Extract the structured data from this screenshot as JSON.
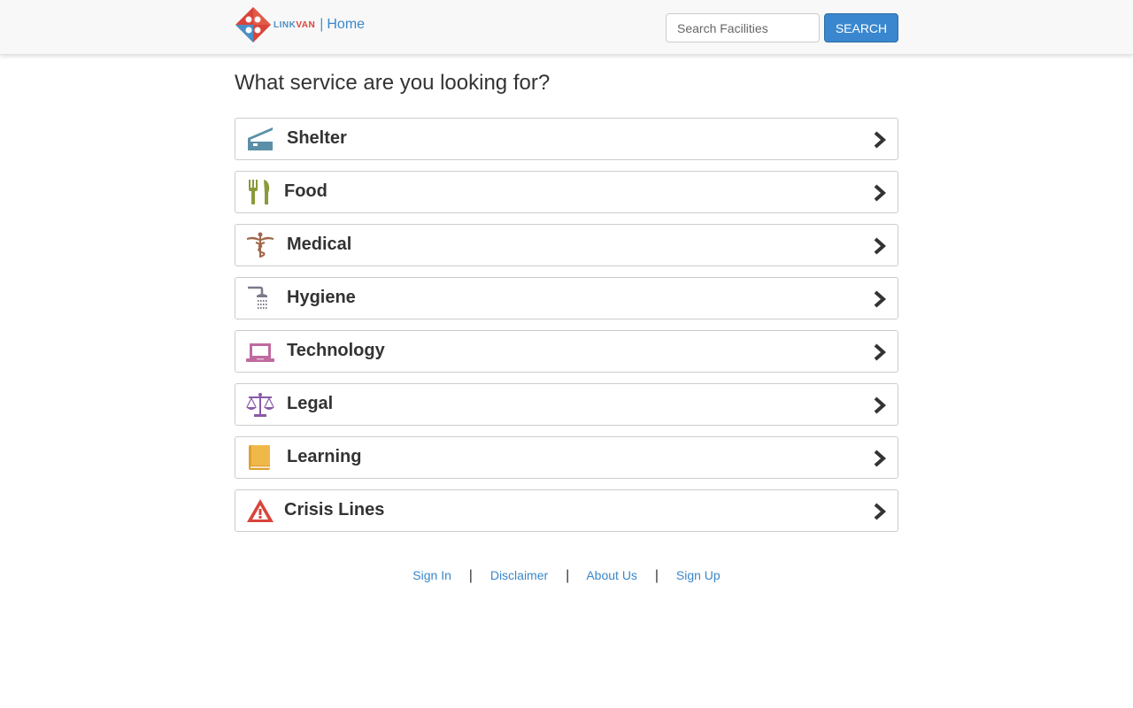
{
  "header": {
    "logo_text_a": "LINK",
    "logo_text_b": "VAN",
    "separator": "|",
    "home_label": "Home",
    "search_placeholder": "Search Facilities",
    "search_button": "SEARCH"
  },
  "main": {
    "heading": "What service are you looking for?",
    "services": [
      {
        "label": "Shelter",
        "icon": "bed-icon",
        "color": "#5b8fa8"
      },
      {
        "label": "Food",
        "icon": "fork-knife-icon",
        "color": "#8a9a3a"
      },
      {
        "label": "Medical",
        "icon": "caduceus-icon",
        "color": "#a0674a"
      },
      {
        "label": "Hygiene",
        "icon": "shower-icon",
        "color": "#7a7a8a"
      },
      {
        "label": "Technology",
        "icon": "laptop-icon",
        "color": "#c06aa0"
      },
      {
        "label": "Legal",
        "icon": "scales-icon",
        "color": "#8a5aa8"
      },
      {
        "label": "Learning",
        "icon": "book-icon",
        "color": "#e0a030"
      },
      {
        "label": "Crisis Lines",
        "icon": "warning-icon",
        "color": "#d9443a"
      }
    ]
  },
  "footer": {
    "links": [
      "Sign In",
      "Disclaimer",
      "About Us",
      "Sign Up"
    ],
    "separator": "|"
  }
}
